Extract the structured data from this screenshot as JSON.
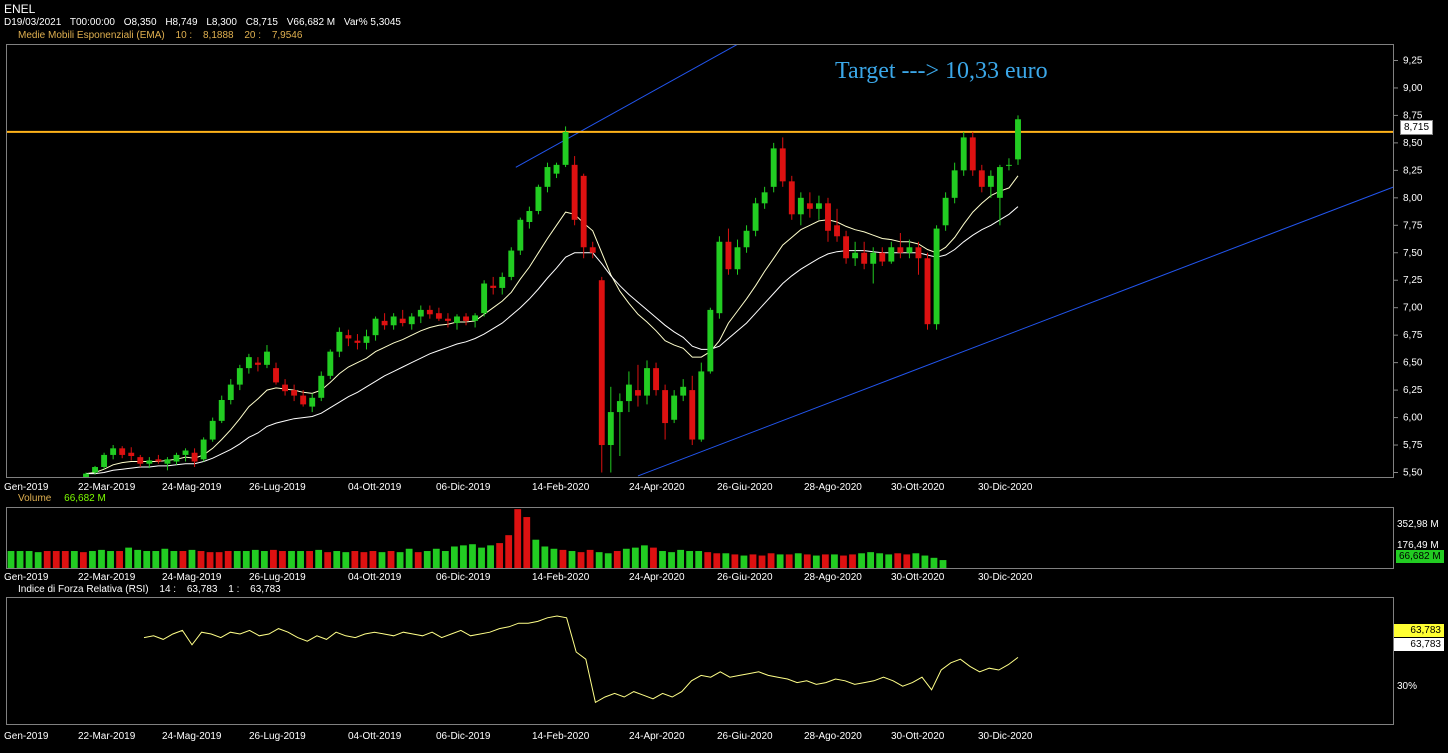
{
  "header": {
    "symbol": "ENEL",
    "date": "D19/03/2021",
    "time": "T00:00:00",
    "open": "O8,350",
    "high": "H8,749",
    "low": "L8,300",
    "close": "C8,715",
    "volume": "V66,682 M",
    "var": "Var% 5,3045"
  },
  "ema": {
    "label": "Medie Mobili Esponenziali (EMA)",
    "p1": "10 :",
    "v1": "8,1888",
    "p2": "20 :",
    "v2": "7,9546"
  },
  "annotation": "Target ---> 10,33 euro",
  "price_tag": "8,715",
  "volume_panel": {
    "label": "Volume",
    "value": "66,682 M",
    "tick_labels": [
      "352,98 M",
      "176,49 M"
    ],
    "current_tag": "66,682 M"
  },
  "rsi_panel": {
    "label": "Indice di Forza Relativa (RSI)",
    "p1": "14 :",
    "v1": "63,783",
    "p2": "1 :",
    "v2": "63,783",
    "level_label": "30%",
    "tag1": "63,783",
    "tag2": "63,783"
  },
  "colors": {
    "up": "#22cc22",
    "down": "#dd1111",
    "ema10": "#ffffcc",
    "ema20": "#ffffff",
    "resistance": "#ffb31a",
    "trendline": "#2255ee",
    "rsi": "#ffff88",
    "target_text": "#3ba7e8"
  },
  "chart_data": [
    {
      "type": "candlestick",
      "title": "ENEL",
      "x_tick_labels": [
        "Gen-2019",
        "22-Mar-2019",
        "24-Mag-2019",
        "26-Lug-2019",
        "04-Ott-2019",
        "06-Dic-2019",
        "14-Feb-2020",
        "24-Apr-2020",
        "26-Giu-2020",
        "28-Ago-2020",
        "30-Ott-2020",
        "30-Dic-2020"
      ],
      "y_ticks": [
        "9,25",
        "9,00",
        "8,75",
        "8,50",
        "8,25",
        "8,00",
        "7,75",
        "7,50",
        "7,25",
        "7,00",
        "6,75",
        "6,50",
        "6,25",
        "6,00",
        "5,75",
        "5,50"
      ],
      "ylim": [
        5.45,
        9.4
      ],
      "candles": [
        [
          5.45,
          5.5,
          5.43,
          5.49
        ],
        [
          5.5,
          5.56,
          5.48,
          5.55
        ],
        [
          5.55,
          5.68,
          5.53,
          5.66
        ],
        [
          5.66,
          5.75,
          5.62,
          5.72
        ],
        [
          5.72,
          5.74,
          5.63,
          5.66
        ],
        [
          5.68,
          5.73,
          5.61,
          5.65
        ],
        [
          5.64,
          5.66,
          5.55,
          5.58
        ],
        [
          5.58,
          5.64,
          5.54,
          5.61
        ],
        [
          5.62,
          5.66,
          5.58,
          5.6
        ],
        [
          5.58,
          5.64,
          5.52,
          5.62
        ],
        [
          5.6,
          5.68,
          5.57,
          5.66
        ],
        [
          5.66,
          5.72,
          5.6,
          5.7
        ],
        [
          5.68,
          5.72,
          5.55,
          5.6
        ],
        [
          5.62,
          5.82,
          5.6,
          5.8
        ],
        [
          5.8,
          6.0,
          5.78,
          5.97
        ],
        [
          5.97,
          6.2,
          5.95,
          6.16
        ],
        [
          6.16,
          6.35,
          6.12,
          6.3
        ],
        [
          6.3,
          6.48,
          6.25,
          6.45
        ],
        [
          6.45,
          6.58,
          6.4,
          6.55
        ],
        [
          6.5,
          6.55,
          6.42,
          6.48
        ],
        [
          6.48,
          6.66,
          6.45,
          6.6
        ],
        [
          6.45,
          6.5,
          6.3,
          6.32
        ],
        [
          6.3,
          6.35,
          6.2,
          6.24
        ],
        [
          6.25,
          6.3,
          6.15,
          6.2
        ],
        [
          6.2,
          6.25,
          6.1,
          6.12
        ],
        [
          6.1,
          6.22,
          6.05,
          6.18
        ],
        [
          6.18,
          6.42,
          6.15,
          6.38
        ],
        [
          6.38,
          6.62,
          6.35,
          6.6
        ],
        [
          6.6,
          6.82,
          6.55,
          6.78
        ],
        [
          6.75,
          6.8,
          6.65,
          6.72
        ],
        [
          6.7,
          6.76,
          6.62,
          6.68
        ],
        [
          6.68,
          6.8,
          6.62,
          6.74
        ],
        [
          6.75,
          6.92,
          6.7,
          6.9
        ],
        [
          6.88,
          6.95,
          6.8,
          6.84
        ],
        [
          6.84,
          6.95,
          6.8,
          6.92
        ],
        [
          6.9,
          6.98,
          6.83,
          6.86
        ],
        [
          6.85,
          6.95,
          6.8,
          6.92
        ],
        [
          6.92,
          7.02,
          6.86,
          6.98
        ],
        [
          6.98,
          7.02,
          6.9,
          6.94
        ],
        [
          6.95,
          7.0,
          6.88,
          6.9
        ],
        [
          6.9,
          6.95,
          6.82,
          6.88
        ],
        [
          6.86,
          6.94,
          6.8,
          6.92
        ],
        [
          6.92,
          6.95,
          6.84,
          6.88
        ],
        [
          6.88,
          6.95,
          6.82,
          6.93
        ],
        [
          6.95,
          7.25,
          6.92,
          7.22
        ],
        [
          7.2,
          7.28,
          7.12,
          7.18
        ],
        [
          7.18,
          7.32,
          7.12,
          7.28
        ],
        [
          7.28,
          7.55,
          7.25,
          7.52
        ],
        [
          7.52,
          7.82,
          7.48,
          7.8
        ],
        [
          7.78,
          7.92,
          7.72,
          7.88
        ],
        [
          7.88,
          8.12,
          7.85,
          8.1
        ],
        [
          8.1,
          8.32,
          8.05,
          8.28
        ],
        [
          8.22,
          8.32,
          8.18,
          8.3
        ],
        [
          8.3,
          8.65,
          8.28,
          8.6
        ],
        [
          8.3,
          8.38,
          7.75,
          7.8
        ],
        [
          8.2,
          8.22,
          7.45,
          7.55
        ],
        [
          7.55,
          7.6,
          7.45,
          7.5
        ],
        [
          7.25,
          7.28,
          5.5,
          5.75
        ],
        [
          5.75,
          6.28,
          5.5,
          6.05
        ],
        [
          6.05,
          6.22,
          5.65,
          6.15
        ],
        [
          6.15,
          6.42,
          6.05,
          6.3
        ],
        [
          6.25,
          6.48,
          6.1,
          6.2
        ],
        [
          6.2,
          6.52,
          6.12,
          6.45
        ],
        [
          6.45,
          6.5,
          6.2,
          6.25
        ],
        [
          6.25,
          6.3,
          5.8,
          5.95
        ],
        [
          5.98,
          6.25,
          5.95,
          6.2
        ],
        [
          6.2,
          6.35,
          6.15,
          6.28
        ],
        [
          6.25,
          6.38,
          5.75,
          5.8
        ],
        [
          5.8,
          6.5,
          5.78,
          6.42
        ],
        [
          6.42,
          7.0,
          6.4,
          6.98
        ],
        [
          6.95,
          7.65,
          6.9,
          7.6
        ],
        [
          7.6,
          7.72,
          7.3,
          7.35
        ],
        [
          7.35,
          7.62,
          7.3,
          7.55
        ],
        [
          7.55,
          7.75,
          7.5,
          7.7
        ],
        [
          7.7,
          8.0,
          7.65,
          7.95
        ],
        [
          7.95,
          8.1,
          7.9,
          8.05
        ],
        [
          8.1,
          8.5,
          8.05,
          8.45
        ],
        [
          8.45,
          8.55,
          8.1,
          8.15
        ],
        [
          8.15,
          8.2,
          7.8,
          7.85
        ],
        [
          7.85,
          8.05,
          7.75,
          8.0
        ],
        [
          7.95,
          8.05,
          7.82,
          7.9
        ],
        [
          7.9,
          8.02,
          7.8,
          7.95
        ],
        [
          7.95,
          8.0,
          7.6,
          7.7
        ],
        [
          7.75,
          7.9,
          7.6,
          7.65
        ],
        [
          7.65,
          7.7,
          7.4,
          7.45
        ],
        [
          7.45,
          7.6,
          7.38,
          7.5
        ],
        [
          7.5,
          7.6,
          7.35,
          7.4
        ],
        [
          7.4,
          7.55,
          7.22,
          7.5
        ],
        [
          7.5,
          7.55,
          7.38,
          7.42
        ],
        [
          7.42,
          7.6,
          7.4,
          7.55
        ],
        [
          7.55,
          7.68,
          7.45,
          7.5
        ],
        [
          7.5,
          7.62,
          7.45,
          7.55
        ],
        [
          7.55,
          7.6,
          7.3,
          7.45
        ],
        [
          7.45,
          7.5,
          6.8,
          6.85
        ],
        [
          6.85,
          7.75,
          6.8,
          7.72
        ],
        [
          7.75,
          8.05,
          7.7,
          8.0
        ],
        [
          8.0,
          8.32,
          7.95,
          8.25
        ],
        [
          8.25,
          8.6,
          8.2,
          8.55
        ],
        [
          8.55,
          8.6,
          8.2,
          8.25
        ],
        [
          8.25,
          8.3,
          8.05,
          8.1
        ],
        [
          8.1,
          8.25,
          8.0,
          8.2
        ],
        [
          8.0,
          8.3,
          7.75,
          8.28
        ],
        [
          8.3,
          8.36,
          8.25,
          8.3
        ],
        [
          8.35,
          8.75,
          8.3,
          8.715
        ]
      ],
      "ema10": [
        5.49,
        5.5,
        5.53,
        5.57,
        5.59,
        5.6,
        5.6,
        5.6,
        5.6,
        5.61,
        5.62,
        5.64,
        5.63,
        5.66,
        5.72,
        5.8,
        5.89,
        5.99,
        6.1,
        6.17,
        6.25,
        6.27,
        6.26,
        6.25,
        6.23,
        6.22,
        6.25,
        6.32,
        6.4,
        6.46,
        6.5,
        6.54,
        6.6,
        6.64,
        6.68,
        6.71,
        6.75,
        6.79,
        6.82,
        6.84,
        6.85,
        6.87,
        6.87,
        6.88,
        6.94,
        7.0,
        7.06,
        7.14,
        7.26,
        7.37,
        7.5,
        7.63,
        7.75,
        7.87,
        7.85,
        7.77,
        7.7,
        7.5,
        7.3,
        7.15,
        7.04,
        6.94,
        6.87,
        6.79,
        6.7,
        6.66,
        6.63,
        6.55,
        6.55,
        6.6,
        6.7,
        6.86,
        6.97,
        7.08,
        7.2,
        7.33,
        7.45,
        7.57,
        7.64,
        7.71,
        7.75,
        7.79,
        7.8,
        7.78,
        7.74,
        7.71,
        7.69,
        7.66,
        7.63,
        7.62,
        7.6,
        7.6,
        7.58,
        7.53,
        7.5,
        7.55,
        7.64,
        7.76,
        7.87,
        7.95,
        8.02,
        8.06,
        8.09,
        8.2
      ],
      "ema20": [
        5.49,
        5.49,
        5.5,
        5.52,
        5.53,
        5.54,
        5.55,
        5.55,
        5.56,
        5.56,
        5.57,
        5.58,
        5.58,
        5.6,
        5.63,
        5.67,
        5.71,
        5.76,
        5.82,
        5.86,
        5.92,
        5.95,
        5.97,
        5.99,
        6.0,
        6.01,
        6.04,
        6.09,
        6.14,
        6.19,
        6.23,
        6.28,
        6.33,
        6.38,
        6.42,
        6.46,
        6.5,
        6.54,
        6.58,
        6.61,
        6.64,
        6.67,
        6.69,
        6.72,
        6.76,
        6.81,
        6.86,
        6.93,
        7.0,
        7.08,
        7.17,
        7.27,
        7.36,
        7.46,
        7.5,
        7.5,
        7.5,
        7.4,
        7.29,
        7.2,
        7.12,
        7.05,
        6.98,
        6.91,
        6.84,
        6.78,
        6.73,
        6.65,
        6.62,
        6.62,
        6.65,
        6.72,
        6.79,
        6.86,
        6.95,
        7.04,
        7.13,
        7.22,
        7.29,
        7.35,
        7.4,
        7.45,
        7.49,
        7.51,
        7.52,
        7.52,
        7.52,
        7.51,
        7.5,
        7.5,
        7.5,
        7.5,
        7.5,
        7.48,
        7.46,
        7.48,
        7.53,
        7.6,
        7.66,
        7.71,
        7.75,
        7.8,
        7.85,
        7.92
      ],
      "resistance": 8.6,
      "annotation": "Target ---> 10,33 euro"
    },
    {
      "type": "bar",
      "title": "Volume",
      "y_ticks": [
        "352,98 M",
        "176,49 M"
      ],
      "ymax": 530,
      "values": [
        150,
        150,
        150,
        140,
        150,
        150,
        150,
        150,
        140,
        150,
        160,
        150,
        150,
        180,
        160,
        150,
        150,
        170,
        150,
        150,
        160,
        150,
        140,
        140,
        150,
        150,
        150,
        160,
        150,
        160,
        150,
        150,
        150,
        150,
        160,
        140,
        150,
        140,
        150,
        140,
        150,
        140,
        150,
        140,
        170,
        140,
        150,
        170,
        150,
        190,
        200,
        210,
        180,
        200,
        220,
        290,
        520,
        450,
        250,
        190,
        170,
        160,
        150,
        140,
        160,
        140,
        130,
        150,
        170,
        180,
        200,
        180,
        150,
        140,
        160,
        150,
        150,
        140,
        130,
        130,
        120,
        110,
        120,
        110,
        130,
        120,
        120,
        130,
        120,
        110,
        120,
        120,
        110,
        120,
        130,
        140,
        130,
        120,
        130,
        120,
        130,
        110,
        90,
        70
      ]
    },
    {
      "type": "line",
      "title": "Indice di Forza Relativa (RSI)",
      "y_ticks": [
        "30%"
      ],
      "ylim": [
        20,
        90
      ],
      "values": [
        68,
        69,
        67,
        70,
        72,
        64,
        71,
        70,
        68,
        71,
        70,
        72,
        69,
        70,
        73,
        71,
        68,
        66,
        69,
        67,
        71,
        69,
        68,
        70,
        71,
        70,
        69,
        71,
        70,
        69,
        71,
        68,
        70,
        72,
        69,
        70,
        71,
        73,
        74,
        76,
        76,
        77,
        79,
        80,
        79,
        60,
        56,
        32,
        35,
        37,
        35,
        38,
        36,
        34,
        37,
        35,
        38,
        44,
        47,
        46,
        49,
        46,
        47,
        48,
        49,
        47,
        46,
        45,
        43,
        44,
        42,
        43,
        45,
        44,
        42,
        43,
        44,
        46,
        44,
        41,
        43,
        46,
        39,
        50,
        54,
        56,
        52,
        49,
        51,
        50,
        53,
        57
      ]
    }
  ]
}
